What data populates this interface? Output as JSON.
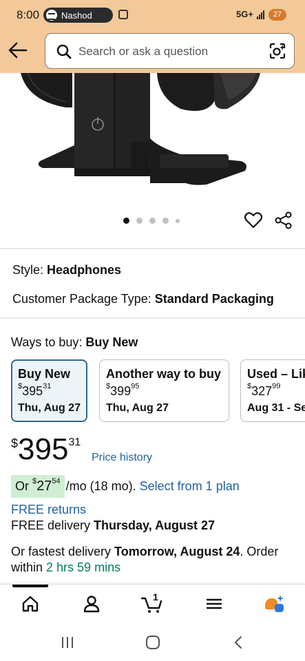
{
  "status_bar": {
    "time": "8:00",
    "app_name": "Nashod",
    "network": "5G+",
    "battery": "27"
  },
  "search": {
    "placeholder": "Search or ask a question"
  },
  "gallery": {
    "dot_count": 5,
    "active_dot": 0
  },
  "style": {
    "label": "Style:",
    "value": "Headphones"
  },
  "package": {
    "label": "Customer Package Type:",
    "value": "Standard Packaging"
  },
  "ways_to_buy": {
    "label": "Ways to buy:",
    "value": "Buy New"
  },
  "options": [
    {
      "title": "Buy New",
      "currency": "$",
      "whole": "395",
      "fraction": "31",
      "date": "Thu, Aug 27",
      "selected": true
    },
    {
      "title": "Another way to buy",
      "currency": "$",
      "whole": "399",
      "fraction": "95",
      "date": "Thu, Aug 27",
      "selected": false
    },
    {
      "title": "Used – Lik",
      "currency": "$",
      "whole": "327",
      "fraction": "99",
      "date": "Aug 31 - Se",
      "selected": false
    }
  ],
  "price": {
    "currency": "$",
    "whole": "395",
    "fraction": "31",
    "history_link": "Price history"
  },
  "monthly": {
    "prefix": "Or ",
    "currency": "$",
    "whole": "27",
    "fraction": "54",
    "suffix": "/mo (18 mo).",
    "link": "Select from 1 plan"
  },
  "free_returns": "FREE returns",
  "delivery": {
    "prefix": "FREE delivery ",
    "date": "Thursday, August 27"
  },
  "fastest": {
    "prefix": "Or fastest delivery ",
    "date": "Tomorrow, August 24",
    "middle": ". Order within ",
    "countdown": "2 hrs 59 mins"
  },
  "cart": {
    "count": "1"
  },
  "colors": {
    "header_bg": "#f3c99a",
    "link": "#2162a1",
    "selected_border": "#2e6a8e",
    "monthly_highlight": "#cfeed2",
    "countdown_green": "#067d62"
  }
}
